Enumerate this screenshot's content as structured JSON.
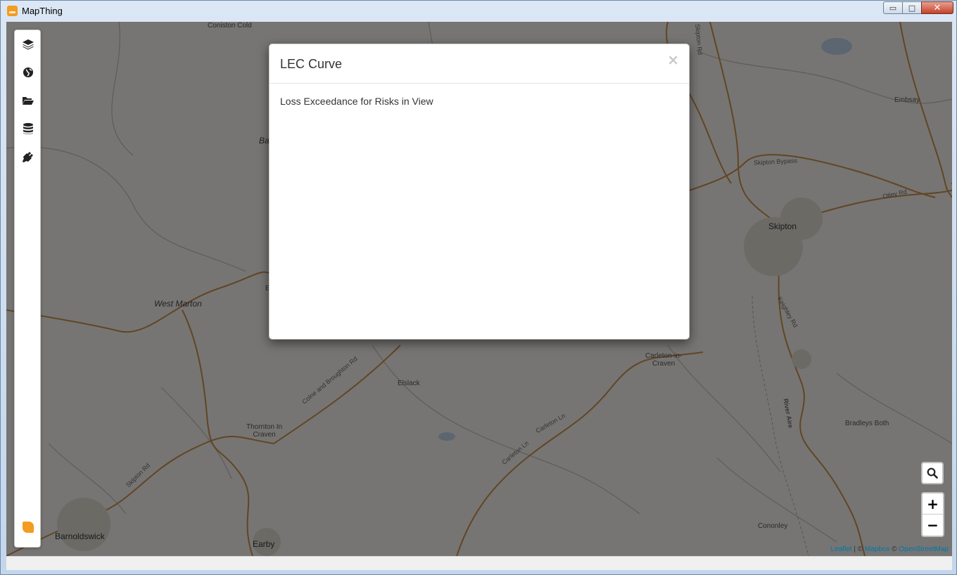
{
  "window": {
    "title": "MapThing",
    "minimize_label": "▭",
    "maximize_label": "□",
    "close_label": "✕"
  },
  "sidebar": {
    "items": [
      {
        "icon": "layers-icon"
      },
      {
        "icon": "globe-icon"
      },
      {
        "icon": "folder-open-icon"
      },
      {
        "icon": "database-icon"
      },
      {
        "icon": "plug-icon"
      }
    ],
    "brand_icon": "mapthing-logo-icon"
  },
  "map": {
    "places": {
      "coniston_cold": "Coniston Cold",
      "embsay": "Embsay",
      "skipton": "Skipton",
      "west_marton": "West Marton",
      "carleton": "Carleton-in-\nCraven",
      "elslack": "Elslack",
      "thornton": "Thornton In\nCraven",
      "bradleys_both": "Bradleys Both",
      "barnoldswick": "Barnoldswick",
      "earby": "Earby",
      "cononley": "Cononley",
      "ba": "Ba",
      "e": "E"
    },
    "roads": {
      "skipton_bypass": "Skipton Bypass",
      "otley_rd": "Otley Rd",
      "keighley_rd": "Keighley Rd",
      "river_aire": "River Aire",
      "colne_rd": "Colne and Broughton Rd",
      "skipton_rd": "Skipton Rd",
      "carleton_ln": "Carleton Ln",
      "carleton_ln2": "Carleton Ln",
      "skipton_rd_top": "Skipton Rd"
    }
  },
  "controls": {
    "search_icon": "search-icon",
    "zoom_in": "+",
    "zoom_out": "−"
  },
  "attribution": {
    "leaflet": "Leaflet",
    "sep1": " | © ",
    "mapbox": "Mapbox",
    "sep2": " © ",
    "osm": "OpenStreetMap"
  },
  "modal": {
    "title": "LEC Curve",
    "close": "×",
    "subtitle": "Loss Exceedance for Risks in View"
  }
}
